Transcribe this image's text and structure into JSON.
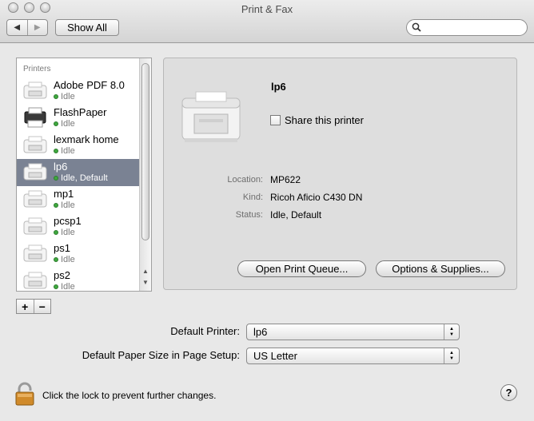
{
  "window": {
    "title": "Print & Fax",
    "show_all_label": "Show All",
    "back_glyph": "◀",
    "forward_glyph": "▶",
    "search_placeholder": ""
  },
  "printers_list": {
    "header": "Printers",
    "items": [
      {
        "name": "Adobe PDF 8.0",
        "status": "Idle",
        "icon": "printer-icon",
        "selected": false
      },
      {
        "name": "FlashPaper",
        "status": "Idle",
        "icon": "printer-dark-icon",
        "selected": false
      },
      {
        "name": "lexmark home",
        "status": "Idle",
        "icon": "printer-icon",
        "selected": false
      },
      {
        "name": "lp6",
        "status": "Idle, Default",
        "icon": "printer-icon",
        "selected": true
      },
      {
        "name": "mp1",
        "status": "Idle",
        "icon": "printer-icon",
        "selected": false
      },
      {
        "name": "pcsp1",
        "status": "Idle",
        "icon": "printer-icon",
        "selected": false
      },
      {
        "name": "ps1",
        "status": "Idle",
        "icon": "printer-icon",
        "selected": false
      },
      {
        "name": "ps2",
        "status": "Idle",
        "icon": "printer-icon",
        "selected": false
      }
    ],
    "add_label": "+",
    "remove_label": "−"
  },
  "detail": {
    "name": "lp6",
    "share_label": "Share this printer",
    "share_checked": false,
    "location_label": "Location:",
    "location_value": "MP622",
    "kind_label": "Kind:",
    "kind_value": "Ricoh Aficio C430 DN",
    "status_label": "Status:",
    "status_value": "Idle, Default",
    "open_queue_label": "Open Print Queue...",
    "options_label": "Options & Supplies..."
  },
  "defaults": {
    "printer_label": "Default Printer:",
    "printer_value": "lp6",
    "paper_label": "Default Paper Size in Page Setup:",
    "paper_value": "US Letter"
  },
  "footer": {
    "lock_text": "Click the lock to prevent further changes.",
    "help_label": "?"
  },
  "colors": {
    "selection": "#7a8293",
    "status_idle": "#3fa83f"
  }
}
